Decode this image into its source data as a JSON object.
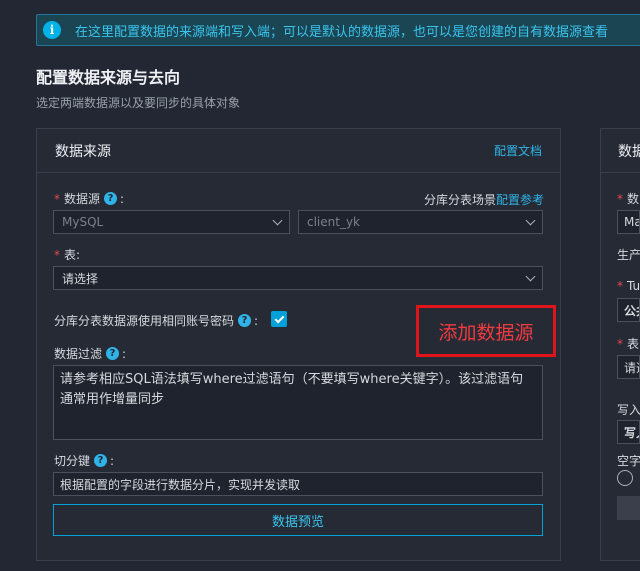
{
  "banner": {
    "text": "在这里配置数据的来源端和写入端；可以是默认的数据源，也可以是您创建的自有数据源查看"
  },
  "header": {
    "title": "配置数据来源与去向",
    "subtitle": "选定两端数据源以及要同步的具体对象"
  },
  "source": {
    "title": "数据来源",
    "doc_link": "配置文档",
    "datasource_label": "数据源",
    "sharding_hint": "分库分表场景",
    "sharding_link": "配置参考",
    "datasource_type": "MySQL",
    "datasource_name": "client_yk",
    "table_label": "表",
    "table_placeholder": "请选择",
    "same_account_label": "分库分表数据源使用相同账号密码",
    "filter_label": "数据过滤",
    "filter_placeholder": "请参考相应SQL语法填写where过滤语句（不要填写where关键字）。该过滤语句通常用作增量同步",
    "split_label": "切分键",
    "split_placeholder": "根据配置的字段进行数据分片，实现并发读取",
    "preview_button": "数据预览"
  },
  "annotation": {
    "text": "添加数据源"
  },
  "target": {
    "title": "数据",
    "field1_label": "数",
    "field1_value": "Ma",
    "line2": "生产",
    "field2_label": "Tu",
    "field2_value": "公共",
    "field3_label": "表",
    "field3_value": "请选",
    "field4_label": "写入",
    "field4_value": "写入",
    "field5_label": "空字"
  }
}
